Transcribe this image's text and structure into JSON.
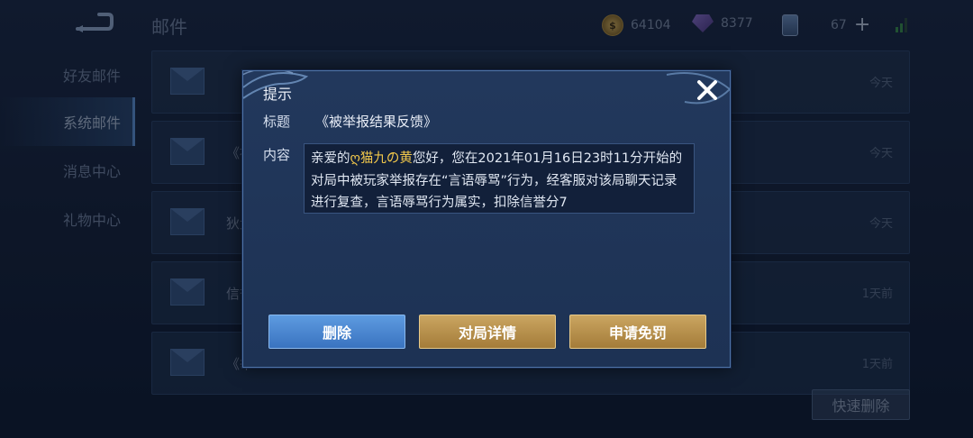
{
  "header": {
    "title": "邮件"
  },
  "currencies": [
    {
      "icon": "gold-coin-icon",
      "value": "64104"
    },
    {
      "icon": "gem-icon",
      "value": "8377"
    },
    {
      "icon": "card-icon",
      "value": "67"
    }
  ],
  "sidebar": {
    "items": [
      {
        "label": "好友邮件",
        "active": false
      },
      {
        "label": "系统邮件",
        "active": true
      },
      {
        "label": "消息中心",
        "active": false
      },
      {
        "label": "礼物中心",
        "active": false
      }
    ]
  },
  "mails": [
    {
      "title": "",
      "time": "今天"
    },
    {
      "title": "《被",
      "time": "今天"
    },
    {
      "title": "狄大",
      "time": "今天"
    },
    {
      "title": "信誉",
      "time": "1天前"
    },
    {
      "title": "《举",
      "time": "1天前"
    }
  ],
  "quick_delete": "快速删除",
  "dialog": {
    "title": "提示",
    "subject_label": "标题",
    "subject": "《被举报结果反馈》",
    "content_label": "内容",
    "content_prefix": "亲爱的",
    "player_name": "ღ猫九の黄",
    "content_body": "您好，您在2021年01月16日23时11分开始的对局中被玩家举报存在“言语辱骂”行为，经客服对该局聊天记录进行复查，言语辱骂行为属实，扣除信誉分7",
    "buttons": {
      "delete": "删除",
      "match_detail": "对局详情",
      "appeal": "申请免罚"
    }
  }
}
